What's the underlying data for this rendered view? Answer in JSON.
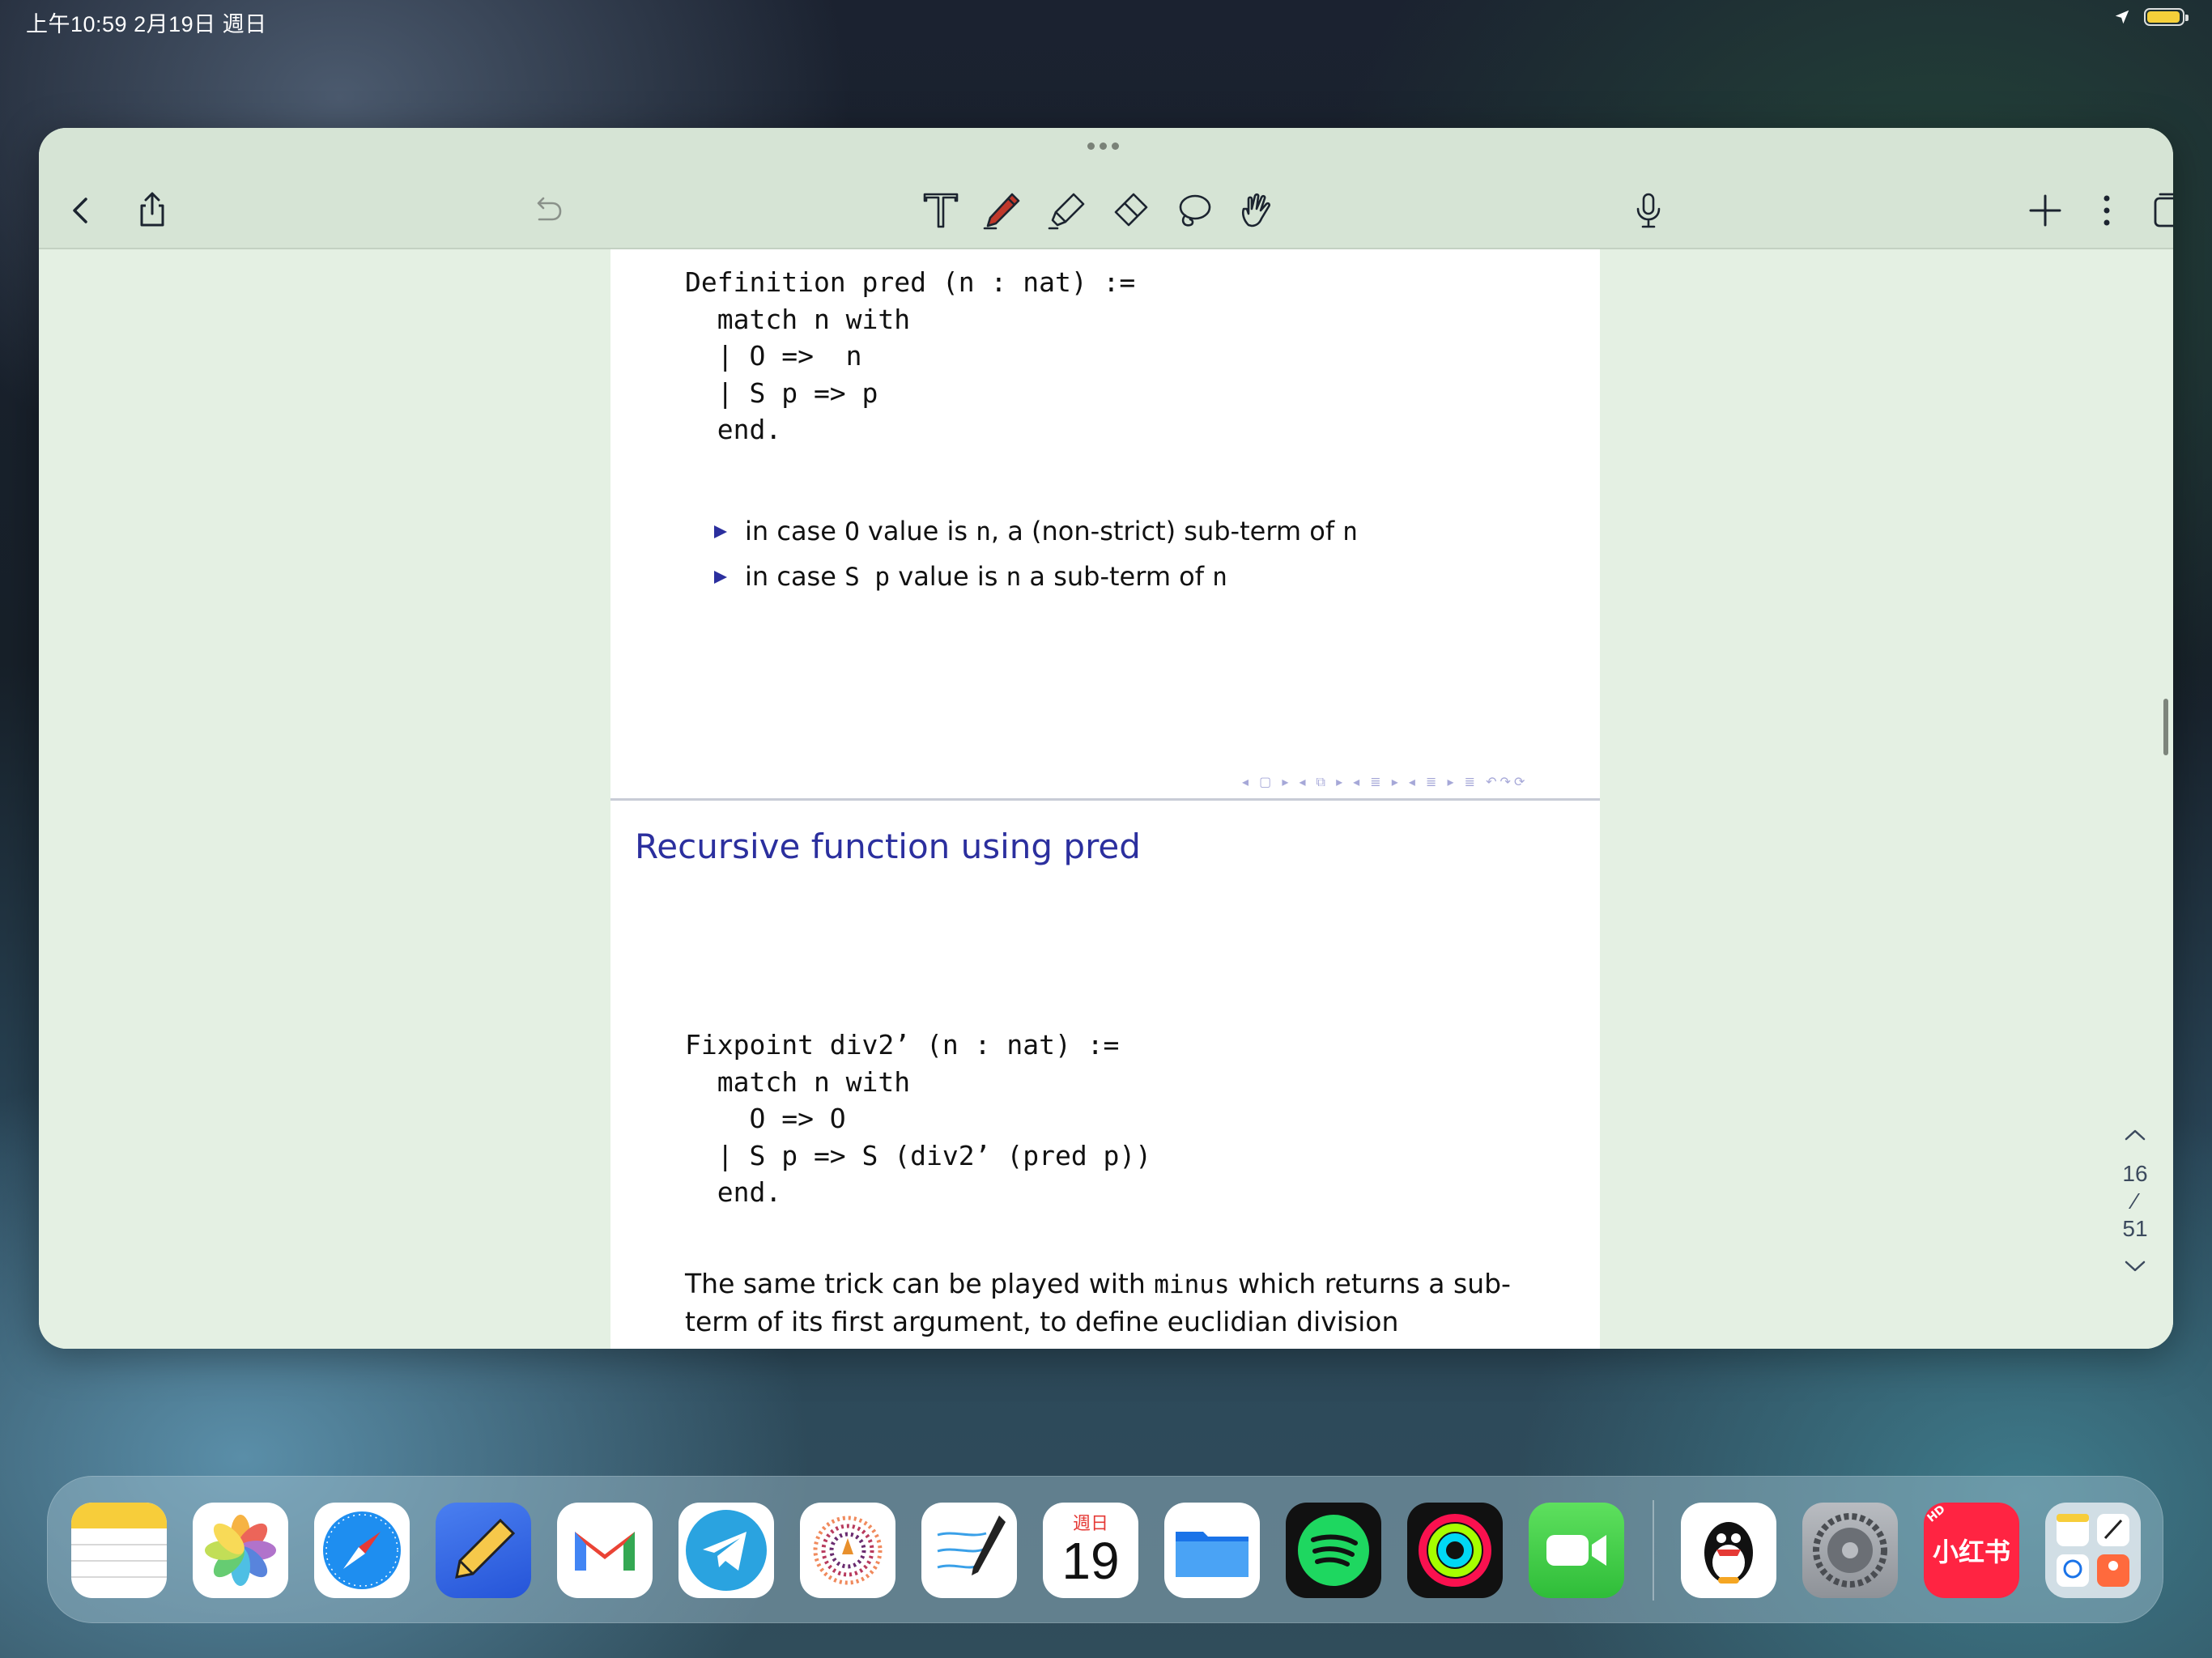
{
  "status_bar": {
    "time_date": "上午10:59   2月19日 週日",
    "battery_color": "#f5d03a"
  },
  "toolbar": {
    "icons": [
      "back-icon",
      "share-icon",
      "undo-icon",
      "text-tool-icon",
      "pen-icon",
      "highlighter-icon",
      "eraser-icon",
      "lasso-icon",
      "hand-tool-icon",
      "microphone-icon",
      "add-icon",
      "more-icon",
      "pages-icon"
    ]
  },
  "document": {
    "slide1": {
      "code_lines": [
        "Definition pred (n : nat) :=",
        "  match n with",
        "  | O =>  n",
        "  | S p => p",
        "  end."
      ],
      "bullets": [
        {
          "pre": "in case ",
          "code": "O",
          "mid": " value is ",
          "code2": "n",
          "post": ", a (non-strict) sub-term of ",
          "code3": "n"
        },
        {
          "pre": "in case ",
          "code": "S p",
          "mid": " value is ",
          "code2": "n",
          "post": " a sub-term of ",
          "code3": "n"
        }
      ],
      "nav_symbols": "◂ ▢ ▸  ◂ ⧉ ▸  ◂ ≣ ▸  ◂ ≣ ▸   ≣   ↶↷⟳"
    },
    "slide2": {
      "title": "Recursive function using pred",
      "code_lines": [
        "Fixpoint div2’ (n : nat) :=",
        "  match n with",
        "    O => O",
        "  | S p => S (div2’ (pred p))",
        "  end."
      ],
      "paragraph": {
        "pre": "The same trick can be played with ",
        "code": "minus",
        "post": " which returns a sub-term of its first argument, to define euclidian division"
      }
    }
  },
  "page_nav": {
    "current": "16",
    "separator": "⁄",
    "total": "51"
  },
  "colors": {
    "accent_blue": "#2b2f9e",
    "toolbar_bg": "#d6e4d5",
    "canvas_bg": "#e4f0e3",
    "pen_red": "#c0392b"
  },
  "calendar": {
    "weekday": "週日",
    "day": "19"
  },
  "dock": {
    "apps": [
      "Notes",
      "Photos",
      "Safari",
      "Pencil app",
      "Gmail",
      "Telegram",
      "App Store style app",
      "Freeform",
      "Calendar",
      "Files",
      "Spotify",
      "Fitness",
      "FaceTime",
      "QQ",
      "Settings",
      "小红书",
      "App Library"
    ],
    "xiaohongshu_label": "小红书",
    "hd_badge": "HD"
  }
}
